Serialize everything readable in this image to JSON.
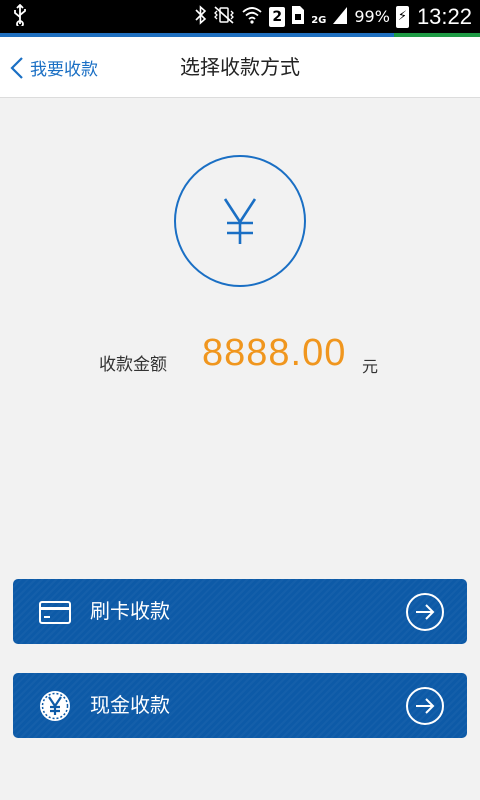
{
  "status_bar": {
    "sim_slot": "2",
    "network": "2G",
    "battery_percent": "99%",
    "battery_icon_text": "⚡",
    "time": "13:22"
  },
  "header": {
    "back_label": "我要收款",
    "title": "选择收款方式"
  },
  "amount": {
    "label": "收款金额",
    "value": "8888.00",
    "unit": "元"
  },
  "payment_methods": [
    {
      "label": "刷卡收款",
      "icon": "card-icon"
    },
    {
      "label": "现金收款",
      "icon": "cash-yuan-icon"
    }
  ],
  "colors": {
    "accent_blue": "#1a6fc4",
    "button_blue": "#0d5aa7",
    "amount_orange": "#f0961e"
  }
}
